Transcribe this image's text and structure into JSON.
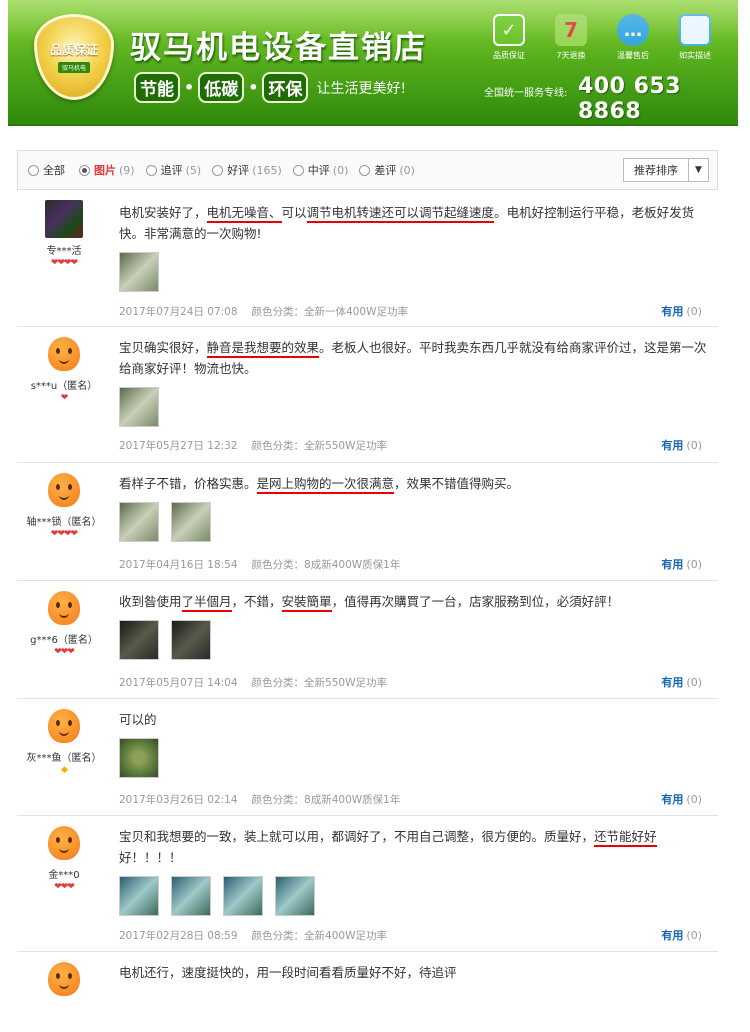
{
  "banner": {
    "badge_title": "品质保证",
    "badge_ribbon": "驭马机电",
    "store_name": "驭马机电设备直销店",
    "slogan_tags": [
      "节能",
      "低碳",
      "环保"
    ],
    "slogan_sub": "让生活更美好!",
    "guarantees": [
      {
        "label": "品质保证",
        "icon": "check-icon",
        "color": "#6cc62a"
      },
      {
        "label": "7天退换",
        "icon": "seven-day-icon",
        "color": "#d8f0b8"
      },
      {
        "label": "温馨售后",
        "icon": "chat-bubble-icon",
        "color": "#38a8e0"
      },
      {
        "label": "如实描述",
        "icon": "document-icon",
        "color": "#4ab0e8"
      }
    ],
    "hotline_label": "全国统一服务专线:",
    "hotline_number": "400 653 8868"
  },
  "filters": [
    {
      "label": "全部",
      "count": "",
      "checked": false
    },
    {
      "label": "图片",
      "count": "(9)",
      "checked": true
    },
    {
      "label": "追评",
      "count": "(5)",
      "checked": false
    },
    {
      "label": "好评",
      "count": "(165)",
      "checked": false
    },
    {
      "label": "中评",
      "count": "(0)",
      "checked": false
    },
    {
      "label": "差评",
      "count": "(0)",
      "checked": false
    }
  ],
  "sort_label": "推荐排序",
  "helpful_label": "有用",
  "reviews": [
    {
      "user": "专***活",
      "hearts": "❤❤❤❤",
      "text_segments": [
        {
          "t": "电机安装好了，",
          "hl": false
        },
        {
          "t": "电机无噪音、",
          "hl": true
        },
        {
          "t": "可以",
          "hl": false
        },
        {
          "t": "调节电机转速还可以调节起缝速度",
          "hl": true
        },
        {
          "t": "。电机好控制运行平稳，老板好发货快。非常满意的一次购物!",
          "hl": false
        }
      ],
      "date": "2017年07月24日 07:08",
      "variant": "颜色分类：全新一体400W足功率",
      "helpful": "(0)"
    },
    {
      "user": "s***u（匿名）",
      "hearts": "❤",
      "text_segments": [
        {
          "t": "宝贝确实很好，",
          "hl": false
        },
        {
          "t": "静音是我想要的效果",
          "hl": true
        },
        {
          "t": "。老板人也很好。平时我卖东西几乎就没有给商家评价过，这是第一次给商家好评！物流也快。",
          "hl": false
        }
      ],
      "date": "2017年05月27日 12:32",
      "variant": "颜色分类：全新550W足功率",
      "helpful": "(0)"
    },
    {
      "user": "轴***锁（匿名）",
      "hearts": "❤❤❤❤",
      "text_segments": [
        {
          "t": "看样子不错，价格实惠。",
          "hl": false
        },
        {
          "t": "是网上购物的一次很满意",
          "hl": true
        },
        {
          "t": "，效果不错值得购买。",
          "hl": false
        }
      ],
      "date": "2017年04月16日 18:54",
      "variant": "颜色分类：8成新400W质保1年",
      "helpful": "(0)"
    },
    {
      "user": "g***6（匿名）",
      "hearts": "❤❤❤",
      "text_segments": [
        {
          "t": "收到昝使用",
          "hl": false
        },
        {
          "t": "了半個月",
          "hl": true
        },
        {
          "t": "，不錯，",
          "hl": false
        },
        {
          "t": "安裝簡單",
          "hl": true
        },
        {
          "t": "，值得再次購買了一台，店家服務到位，必須好評！",
          "hl": false
        }
      ],
      "date": "2017年05月07日 14:04",
      "variant": "颜色分类：全新550W足功率",
      "helpful": "(0)"
    },
    {
      "user": "灰***鱼（匿名）",
      "hearts": "◆",
      "text_segments": [
        {
          "t": "可以的",
          "hl": false
        }
      ],
      "date": "2017年03月26日 02:14",
      "variant": "颜色分类：8成新400W质保1年",
      "helpful": "(0)"
    },
    {
      "user": "金***0",
      "hearts": "❤❤❤",
      "text_segments": [
        {
          "t": "宝贝和我想要的一致，装上就可以用，都调好了，不用自己调整，很方便的。质量好，",
          "hl": false
        },
        {
          "t": "还节能好好",
          "hl": true
        },
        {
          "t": "好！！！！",
          "hl": false
        }
      ],
      "date": "2017年02月28日 08:59",
      "variant": "颜色分类：全新400W足功率",
      "helpful": "(0)"
    },
    {
      "user": "",
      "hearts": "",
      "text_segments": [
        {
          "t": "电机还行，速度挺快的，用一段时间看看质量好不好，待追评",
          "hl": false
        }
      ],
      "date": "",
      "variant": "",
      "helpful": ""
    }
  ]
}
